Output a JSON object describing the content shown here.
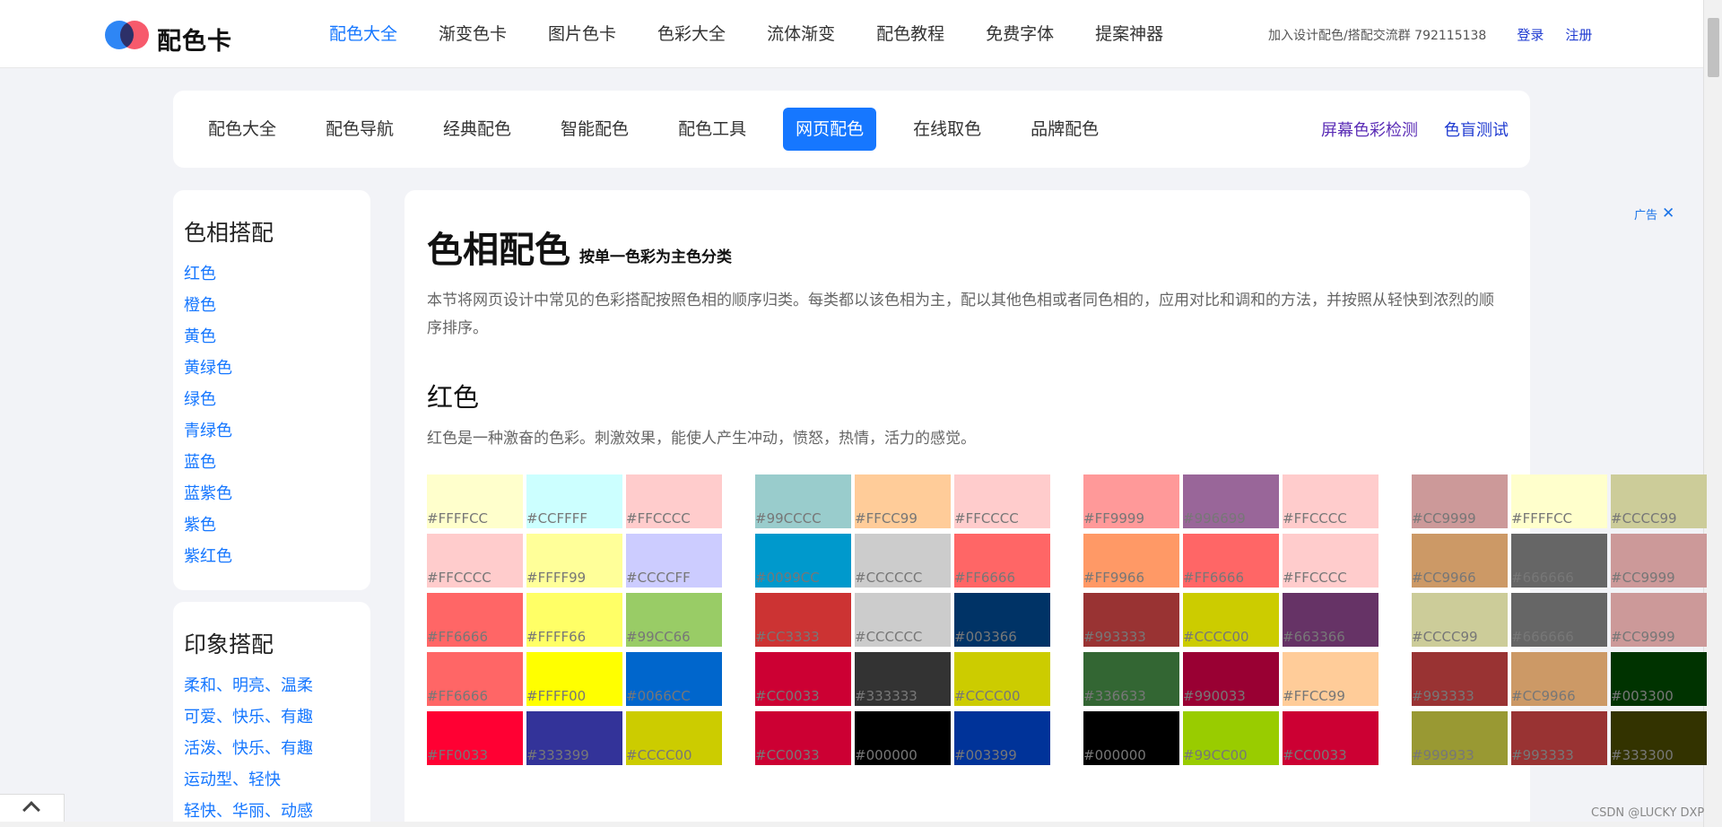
{
  "brand": {
    "name": "配色卡",
    "blue": "#2e86f5",
    "red": "#f75a6c"
  },
  "mainnav": [
    "配色大全",
    "渐变色卡",
    "图片色卡",
    "色彩大全",
    "流体渐变",
    "配色教程",
    "免费字体",
    "提案神器"
  ],
  "topright": {
    "group_text": "加入设计配色/搭配交流群 792115138",
    "login": "登录",
    "register": "注册"
  },
  "subnav": {
    "items": [
      "配色大全",
      "配色导航",
      "经典配色",
      "智能配色",
      "配色工具",
      "网页配色",
      "在线取色",
      "品牌配色"
    ],
    "active_index": 5,
    "right": [
      "屏幕色彩检测",
      "色盲测试"
    ]
  },
  "sidebar": {
    "hue_title": "色相搭配",
    "hue_items": [
      "红色",
      "橙色",
      "黄色",
      "黄绿色",
      "绿色",
      "青绿色",
      "蓝色",
      "蓝紫色",
      "紫色",
      "紫红色"
    ],
    "impression_title": "印象搭配",
    "impression_items": [
      "柔和、明亮、温柔",
      "可爱、快乐、有趣",
      "活泼、快乐、有趣",
      "运动型、轻快",
      "轻快、华丽、动感"
    ]
  },
  "main": {
    "title": "色相配色",
    "subtitle": "按单一色彩为主色分类",
    "intro": "本节将网页设计中常见的色彩搭配按照色相的顺序归类。每类都以该色相为主，配以其他色相或者同色相的，应用对比和调和的方法，并按照从轻快到浓烈的顺序排序。",
    "section_title": "红色",
    "section_desc": "红色是一种激奋的色彩。刺激效果，能使人产生冲动，愤怒，热情，活力的感觉。"
  },
  "ad": {
    "label": "广告",
    "close": "✕"
  },
  "watermark": "CSDN @LUCKY DXP",
  "palettes": [
    [
      [
        "#FFFFCC",
        "#CCFFFF",
        "#FFCCCC"
      ],
      [
        "#FFCCCC",
        "#FFFF99",
        "#CCCCFF"
      ],
      [
        "#FF6666",
        "#FFFF66",
        "#99CC66"
      ],
      [
        "#FF6666",
        "#FFFF00",
        "#0066CC"
      ],
      [
        "#FF0033",
        "#333399",
        "#CCCC00"
      ]
    ],
    [
      [
        "#99CCCC",
        "#FFCC99",
        "#FFCCCC"
      ],
      [
        "#0099CC",
        "#CCCCCC",
        "#FF6666"
      ],
      [
        "#CC3333",
        "#CCCCCC",
        "#003366"
      ],
      [
        "#CC0033",
        "#333333",
        "#CCCC00"
      ],
      [
        "#CC0033",
        "#000000",
        "#003399"
      ]
    ],
    [
      [
        "#FF9999",
        "#996699",
        "#FFCCCC"
      ],
      [
        "#FF9966",
        "#FF6666",
        "#FFCCCC"
      ],
      [
        "#993333",
        "#CCCC00",
        "#663366"
      ],
      [
        "#336633",
        "#990033",
        "#FFCC99"
      ],
      [
        "#000000",
        "#99CC00",
        "#CC0033"
      ]
    ],
    [
      [
        "#CC9999",
        "#FFFFCC",
        "#CCCC99"
      ],
      [
        "#CC9966",
        "#666666",
        "#CC9999"
      ],
      [
        "#CCCC99",
        "#666666",
        "#CC9999"
      ],
      [
        "#993333",
        "#CC9966",
        "#003300"
      ],
      [
        "#999933",
        "#993333",
        "#333300"
      ]
    ]
  ]
}
